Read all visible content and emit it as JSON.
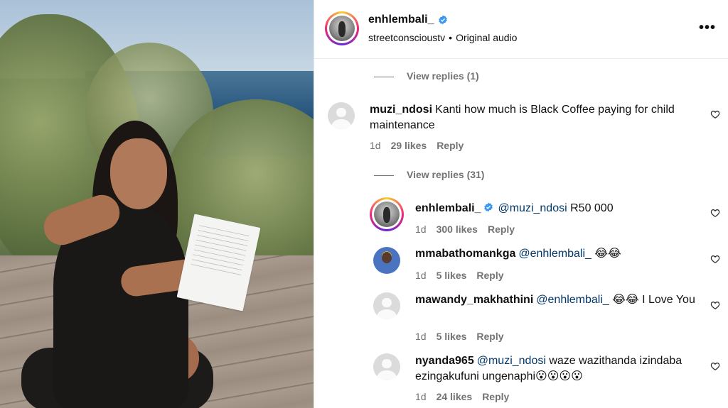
{
  "post": {
    "author": "enhlembali_",
    "subline_account": "streetconscioustv",
    "subline_dot": "•",
    "subline_audio": "Original audio",
    "more_label": "•••"
  },
  "view_replies_1": "View replies (1)",
  "view_replies_2": "View replies (31)",
  "comments": [
    {
      "username": "muzi_ndosi",
      "text": "Kanti how much is Black Coffee paying for child maintenance",
      "time": "1d",
      "likes": "29 likes",
      "reply": "Reply"
    }
  ],
  "replies": [
    {
      "username": "enhlembali_",
      "mention": "@muzi_ndosi",
      "text": "R50 000",
      "time": "1d",
      "likes": "300 likes",
      "reply": "Reply"
    },
    {
      "username": "mmabathomankga",
      "mention": "@enhlembali_",
      "text": "😂😂",
      "time": "1d",
      "likes": "5 likes",
      "reply": "Reply"
    },
    {
      "username": "mawandy_makhathini",
      "mention": "@enhlembali_",
      "text": "😂😂 I Love You",
      "time": "1d",
      "likes": "5 likes",
      "reply": "Reply"
    },
    {
      "username": "nyanda965",
      "mention": "@muzi_ndosi",
      "text": "waze wazithanda izindaba ezingakufuni ungenaphi😮😮😮😮",
      "time": "1d",
      "likes": "24 likes",
      "reply": "Reply"
    }
  ],
  "colors": {
    "verified": "#3897f0",
    "mention": "#00376b",
    "meta": "#737373"
  },
  "icons": {
    "verified": "verified-badge-icon",
    "heart": "heart-outline-icon",
    "more": "more-horizontal-icon"
  }
}
